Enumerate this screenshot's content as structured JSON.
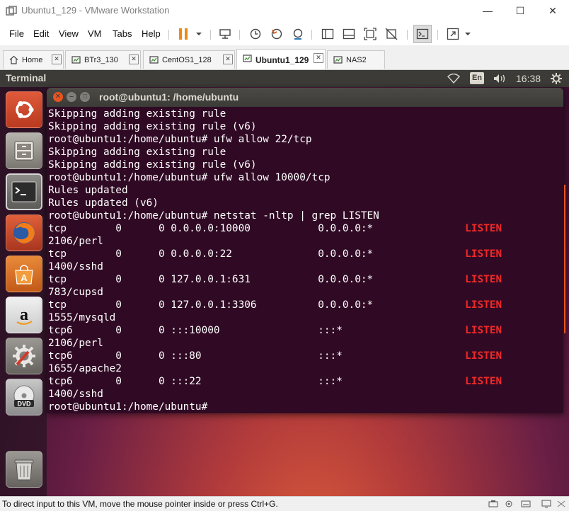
{
  "window": {
    "title": "Ubuntu1_129 - VMware Workstation",
    "controls": {
      "minimize": "—",
      "maximize": "☐",
      "close": "✕"
    }
  },
  "menu": [
    "File",
    "Edit",
    "View",
    "VM",
    "Tabs",
    "Help"
  ],
  "tabs": [
    {
      "label": "Home",
      "icon": "home-icon",
      "active": false
    },
    {
      "label": "BTr3_130",
      "icon": "vm-icon",
      "active": false
    },
    {
      "label": "CentOS1_128",
      "icon": "vm-icon",
      "active": false
    },
    {
      "label": "Ubuntu1_129",
      "icon": "vm-icon",
      "active": true
    },
    {
      "label": "NAS2",
      "icon": "vm-icon",
      "active": false
    }
  ],
  "guest": {
    "topbar_title": "Terminal",
    "language": "En",
    "clock": "16:38",
    "launcher": [
      "ubuntu-dash-icon",
      "files-icon",
      "terminal-icon",
      "firefox-icon",
      "software-center-icon",
      "amazon-icon",
      "system-settings-icon",
      "dvd-icon",
      "trash-icon"
    ]
  },
  "terminal": {
    "title": "root@ubuntu1: /home/ubuntu",
    "lines": [
      {
        "text": "Skipping adding existing rule"
      },
      {
        "text": "Skipping adding existing rule (v6)"
      },
      {
        "text": "root@ubuntu1:/home/ubuntu# ufw allow 22/tcp"
      },
      {
        "text": "Skipping adding existing rule"
      },
      {
        "text": "Skipping adding existing rule (v6)"
      },
      {
        "text": "root@ubuntu1:/home/ubuntu# ufw allow 10000/tcp"
      },
      {
        "text": "Rules updated"
      },
      {
        "text": "Rules updated (v6)"
      },
      {
        "text": "root@ubuntu1:/home/ubuntu# netstat -nltp | grep LISTEN"
      },
      {
        "text": "tcp        0      0 0.0.0.0:10000           0.0.0.0:*               ",
        "state": "LISTEN"
      },
      {
        "text": "2106/perl"
      },
      {
        "text": "tcp        0      0 0.0.0.0:22              0.0.0.0:*               ",
        "state": "LISTEN"
      },
      {
        "text": "1400/sshd"
      },
      {
        "text": "tcp        0      0 127.0.0.1:631           0.0.0.0:*               ",
        "state": "LISTEN"
      },
      {
        "text": "783/cupsd"
      },
      {
        "text": "tcp        0      0 127.0.0.1:3306          0.0.0.0:*               ",
        "state": "LISTEN"
      },
      {
        "text": "1555/mysqld"
      },
      {
        "text": "tcp6       0      0 :::10000                :::*                    ",
        "state": "LISTEN"
      },
      {
        "text": "2106/perl"
      },
      {
        "text": "tcp6       0      0 :::80                   :::*                    ",
        "state": "LISTEN"
      },
      {
        "text": "1655/apache2"
      },
      {
        "text": "tcp6       0      0 :::22                   :::*                    ",
        "state": "LISTEN"
      },
      {
        "text": "1400/sshd"
      },
      {
        "text": "root@ubuntu1:/home/ubuntu# "
      }
    ]
  },
  "status": {
    "message": "To direct input to this VM, move the mouse pointer inside or press Ctrl+G."
  },
  "colors": {
    "terminal_bg": "#300a24",
    "listen_red": "#ef2929",
    "ubuntu_panel": "#3c3b37"
  }
}
